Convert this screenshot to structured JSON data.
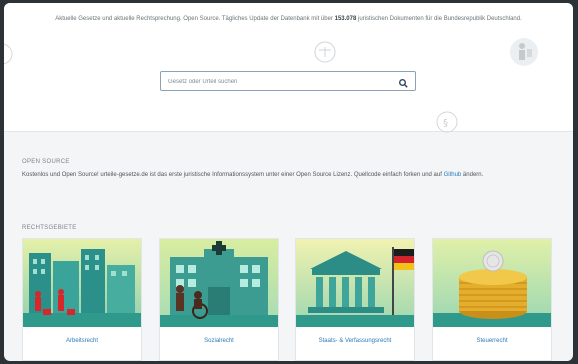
{
  "hero": {
    "text_before": "Aktuelle Gesetze und aktuelle Rechtsprechung. Open Source. Tägliches Update der Datenbank mit über",
    "doc_count": "153.078",
    "text_after": "juristischen Dokumenten für die Bundesrepublik Deutschland."
  },
  "search": {
    "placeholder": "Gesetz oder Urteil suchen",
    "button_icon": "search-icon"
  },
  "open_source": {
    "heading": "OPEN SOURCE",
    "text": "Kostenlos und Open Source! urteile-gesetze.de ist das erste juristische Informationssystem unter einer Open Source Lizenz. Quellcode einfach forken und auf",
    "link": "Github",
    "text_end": " ändern."
  },
  "rechtsgebiete": {
    "heading": "RECHTSGEBIETE",
    "items": [
      {
        "label": "Arbeitsrecht",
        "icon": "office-buildings-illustration"
      },
      {
        "label": "Sozialrecht",
        "icon": "hospital-illustration"
      },
      {
        "label": "Staats- & Verfassungsrecht",
        "icon": "government-building-illustration"
      },
      {
        "label": "Steuerrecht",
        "icon": "coin-stack-illustration"
      }
    ]
  },
  "colors": {
    "link": "#2b7bb9",
    "card_sky_green": "#b7dd7a",
    "card_ground": "#2f9a8c",
    "flag": [
      "#1c1c1c",
      "#d3232b",
      "#f2c21b"
    ]
  }
}
